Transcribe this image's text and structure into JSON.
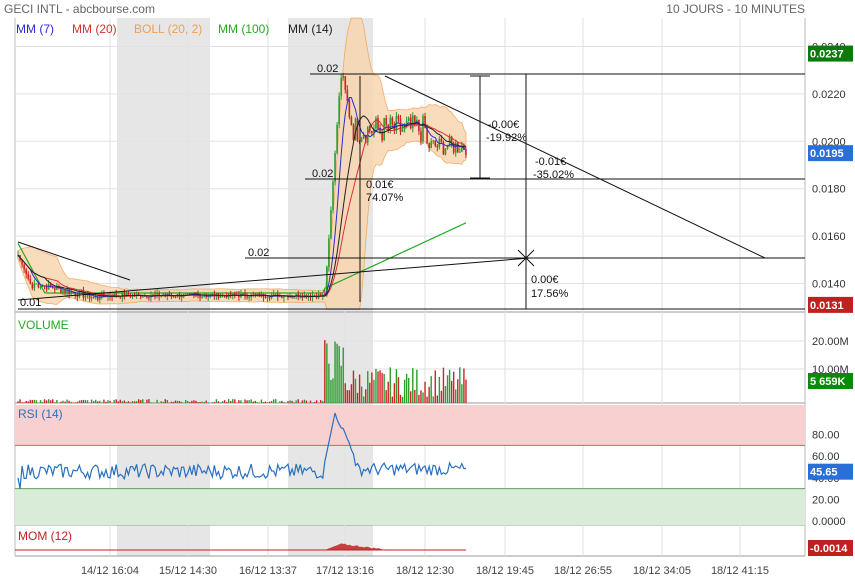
{
  "header": {
    "title": "GECI INTL - abcbourse.com",
    "period": "10 JOURS - 10 MINUTES"
  },
  "legend": [
    {
      "label": "MM (7)",
      "color": "#2a2ad8"
    },
    {
      "label": "MM (20)",
      "color": "#d83030"
    },
    {
      "label": "BOLL (20, 2)",
      "color": "#f0a050"
    },
    {
      "label": "MM (100)",
      "color": "#22aa22"
    },
    {
      "label": "MM (14)",
      "color": "#222222"
    }
  ],
  "colors": {
    "up": "#2a9d2a",
    "down": "#cc2222",
    "boll_fill": "#f8d6b0",
    "session_shade": "#e6e6e6",
    "rsi_overbought": "#f8d0d0",
    "rsi_oversold": "#d8ecd8",
    "rsi_line": "#2a6fc0",
    "mom_fill": "#c02020",
    "vol_tag": "#0a8a0a",
    "price_tag_green": "#0a7a0a",
    "price_tag_blue": "#2a6fd8",
    "price_tag_red": "#c02020"
  },
  "chart_data": [
    {
      "type": "candlestick",
      "panel": "price",
      "ylim": [
        0.0128,
        0.0252
      ],
      "y_ticks": [
        "0.0240",
        "0.0220",
        "0.0200",
        "0.0180",
        "0.0160",
        "0.0140"
      ],
      "y_tick_values": [
        0.024,
        0.022,
        0.02,
        0.018,
        0.016,
        0.014
      ],
      "price_tags": [
        {
          "label": "0.0237",
          "value": 0.0237,
          "color": "#0a7a0a"
        },
        {
          "label": "0.0195",
          "value": 0.0195,
          "color": "#2a6fd8"
        },
        {
          "label": "0.0131",
          "value": 0.0131,
          "color": "#c02020"
        }
      ],
      "x_labels": [
        "14/12 16:04",
        "15/12 14:30",
        "16/12 13:37",
        "17/12 13:16",
        "18/12 12:30",
        "18/12 19:45",
        "18/12 26:55",
        "18/12 34:05",
        "18/12 41:15"
      ],
      "annotations": [
        {
          "text": "0.02"
        },
        {
          "text": "0.02"
        },
        {
          "text": "0.02"
        },
        {
          "text": "0.01"
        },
        {
          "text": "0.01€"
        },
        {
          "text": "74.07%"
        },
        {
          "text": "-0.00€"
        },
        {
          "text": "-19.92%"
        },
        {
          "text": "-0.01€"
        },
        {
          "text": "-35.02%"
        },
        {
          "text": "0.00€"
        },
        {
          "text": "17.56%"
        }
      ]
    },
    {
      "type": "bar",
      "panel": "volume",
      "title": "VOLUME",
      "y_ticks": [
        "20.00M",
        "10.00M"
      ],
      "last_tag": "5 659K"
    },
    {
      "type": "line",
      "panel": "rsi",
      "title": "RSI (14)",
      "y_ticks": [
        "80.00",
        "60.00",
        "40.00",
        "20.00",
        "0.0000"
      ],
      "last_tag": "45.65",
      "overbought": 70,
      "oversold": 30
    },
    {
      "type": "area",
      "panel": "momentum",
      "title": "MOM (12)",
      "last_tag": "-0.0014"
    }
  ]
}
